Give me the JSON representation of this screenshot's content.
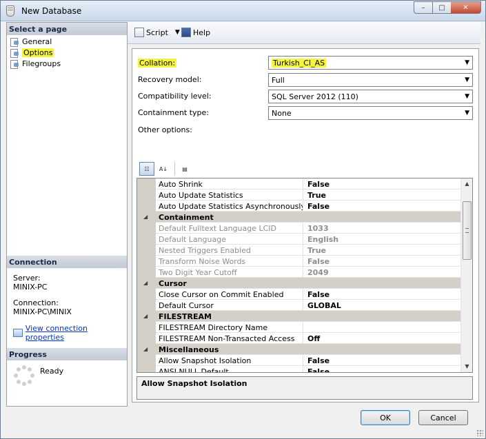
{
  "window": {
    "title": "New Database",
    "minimize": "–",
    "maximize": "□",
    "close": "✕"
  },
  "left": {
    "select_page_header": "Select a page",
    "pages": [
      {
        "label": "General",
        "highlighted": false
      },
      {
        "label": "Options",
        "highlighted": true
      },
      {
        "label": "Filegroups",
        "highlighted": false
      }
    ],
    "connection_header": "Connection",
    "server_label": "Server:",
    "server_value": "MINIX-PC",
    "connection_label": "Connection:",
    "connection_value": "MINIX-PC\\MINIX",
    "view_link": "View connection properties",
    "progress_header": "Progress",
    "progress_status": "Ready"
  },
  "toolbar": {
    "script_label": "Script",
    "help_label": "Help"
  },
  "form": {
    "collation_label": "Collation:",
    "collation_value": "Turkish_CI_AS",
    "recovery_label": "Recovery model:",
    "recovery_value": "Full",
    "compat_label": "Compatibility level:",
    "compat_value": "SQL Server 2012 (110)",
    "containment_label": "Containment type:",
    "containment_value": "None",
    "other_options_label": "Other options:"
  },
  "grid_toolbar": {
    "categorized": "☷",
    "alphabetical": "A↓",
    "properties": "▤"
  },
  "grid": {
    "expand_glyph": "◢",
    "rows": [
      {
        "type": "prop",
        "name": "Auto Shrink",
        "value": "False",
        "disabled": false
      },
      {
        "type": "prop",
        "name": "Auto Update Statistics",
        "value": "True",
        "disabled": false
      },
      {
        "type": "prop",
        "name": "Auto Update Statistics Asynchronously",
        "value": "False",
        "disabled": false
      },
      {
        "type": "cat",
        "name": "Containment"
      },
      {
        "type": "prop",
        "name": "Default Fulltext Language LCID",
        "value": "1033",
        "disabled": true
      },
      {
        "type": "prop",
        "name": "Default Language",
        "value": "English",
        "disabled": true
      },
      {
        "type": "prop",
        "name": "Nested Triggers Enabled",
        "value": "True",
        "disabled": true
      },
      {
        "type": "prop",
        "name": "Transform Noise Words",
        "value": "False",
        "disabled": true
      },
      {
        "type": "prop",
        "name": "Two Digit Year Cutoff",
        "value": "2049",
        "disabled": true
      },
      {
        "type": "cat",
        "name": "Cursor"
      },
      {
        "type": "prop",
        "name": "Close Cursor on Commit Enabled",
        "value": "False",
        "disabled": false
      },
      {
        "type": "prop",
        "name": "Default Cursor",
        "value": "GLOBAL",
        "disabled": false
      },
      {
        "type": "cat",
        "name": "FILESTREAM"
      },
      {
        "type": "prop",
        "name": "FILESTREAM Directory Name",
        "value": "",
        "disabled": false
      },
      {
        "type": "prop",
        "name": "FILESTREAM Non-Transacted Access",
        "value": "Off",
        "disabled": false
      },
      {
        "type": "cat",
        "name": "Miscellaneous"
      },
      {
        "type": "prop",
        "name": "Allow Snapshot Isolation",
        "value": "False",
        "disabled": false
      },
      {
        "type": "prop",
        "name": "ANSI NULL Default",
        "value": "False",
        "disabled": false
      }
    ],
    "scroll_up": "▲",
    "scroll_down": "▼"
  },
  "description": "Allow Snapshot Isolation",
  "buttons": {
    "ok": "OK",
    "cancel": "Cancel"
  },
  "colors": {
    "highlight": "#f5f541",
    "link": "#0033cc",
    "category_bg": "#d4d0c8"
  }
}
